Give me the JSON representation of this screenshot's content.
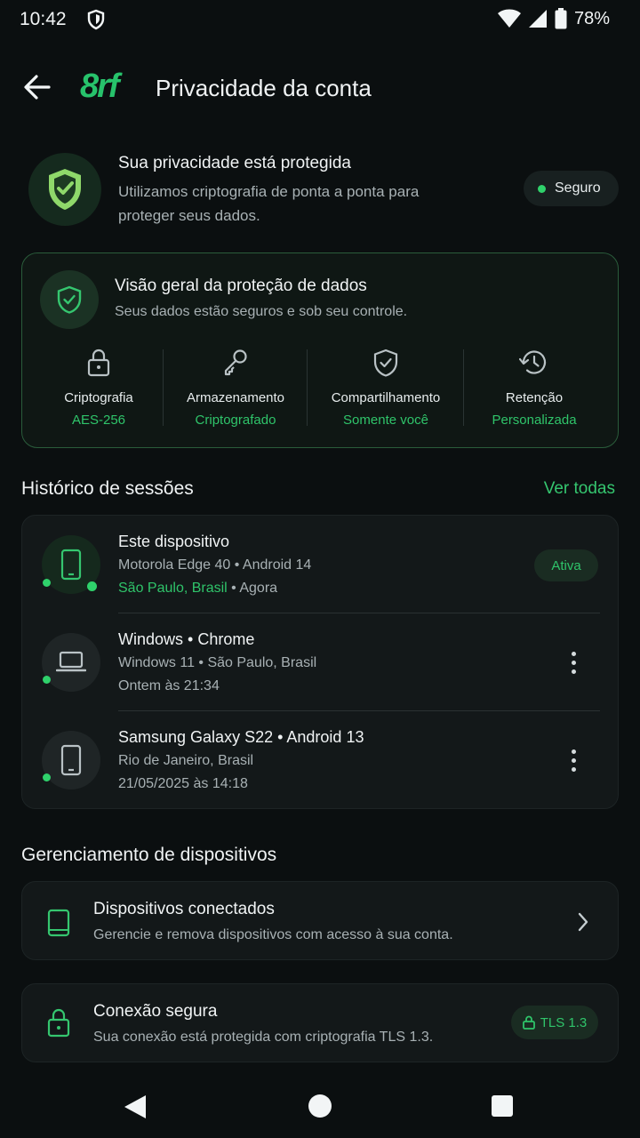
{
  "status_bar": {
    "time": "10:42",
    "battery": "78%"
  },
  "header": {
    "brand": "8rf",
    "title": "Privacidade da conta"
  },
  "privacy": {
    "title": "Sua privacidade está protegida",
    "description": "Utilizamos criptografia de ponta a ponta para proteger seus dados.",
    "badge": "Seguro"
  },
  "overview": {
    "title": "Visão geral da proteção de dados",
    "subtitle": "Seus dados estão seguros e sob seu controle.",
    "items": [
      {
        "label": "Criptografia",
        "value": "AES-256",
        "icon": "lock-icon"
      },
      {
        "label": "Armazenamento",
        "value": "Criptografado",
        "icon": "key-icon"
      },
      {
        "label": "Compartilhamento",
        "value": "Somente você",
        "icon": "shield-check-icon"
      },
      {
        "label": "Retenção",
        "value": "Personalizada",
        "icon": "history-icon"
      }
    ]
  },
  "sessions": {
    "title": "Histórico de sessões",
    "see_all": "Ver todas",
    "items": [
      {
        "name": "Este dispositivo",
        "line2": "Motorola Edge 40 • Android 14",
        "location": "São Paulo, Brasil",
        "time": " • Agora",
        "badge": "Ativa",
        "icon": "phone-icon"
      },
      {
        "name": "Windows • Chrome",
        "line2": "Windows 11 • São Paulo, Brasil",
        "line3": "Ontem às 21:34",
        "icon": "laptop-icon"
      },
      {
        "name": "Samsung Galaxy S22 • Android 13",
        "line2": "Rio de Janeiro, Brasil",
        "line3": "21/05/2025 às 14:18",
        "icon": "phone-icon"
      }
    ]
  },
  "devices": {
    "title": "Gerenciamento de dispositivos",
    "connected": {
      "title": "Dispositivos conectados",
      "description": "Gerencie e remova dispositivos com acesso à sua conta."
    },
    "secure": {
      "title": "Conexão segura",
      "description": "Sua conexão está protegida com criptografia TLS 1.3.",
      "badge": "TLS 1.3"
    }
  },
  "colors": {
    "accent": "#2fc46a",
    "background": "#0b0f10",
    "card": "#131819"
  }
}
